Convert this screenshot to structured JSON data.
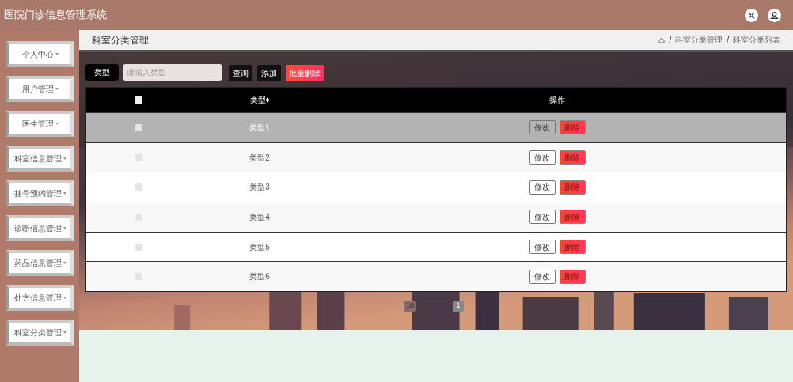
{
  "header": {
    "title": "医院门诊信息管理系统"
  },
  "sidebar": {
    "items": [
      {
        "label": "个人中心"
      },
      {
        "label": "用户管理"
      },
      {
        "label": "医生管理"
      },
      {
        "label": "科室信息管理"
      },
      {
        "label": "挂号预约管理"
      },
      {
        "label": "诊断信息管理"
      },
      {
        "label": "药品信息管理"
      },
      {
        "label": "处方信息管理"
      },
      {
        "label": "科室分类管理"
      }
    ]
  },
  "page": {
    "title": "科室分类管理",
    "breadcrumb": [
      {
        "kind": "separator",
        "text": "/"
      },
      {
        "kind": "link",
        "text": "科室分类管理"
      },
      {
        "kind": "separator",
        "text": "/"
      },
      {
        "kind": "link",
        "text": "科室分类列表"
      }
    ]
  },
  "search": {
    "label": "类型",
    "placeholder": "请输入类型",
    "buttons": [
      {
        "label": "查询",
        "kind": "normal"
      },
      {
        "label": "添加",
        "kind": "normal"
      },
      {
        "label": "批量删除",
        "kind": "danger"
      }
    ]
  },
  "table": {
    "columns": [
      "类型",
      "操作"
    ],
    "all_checked": false,
    "rows": [
      {
        "type": "类型1",
        "checked": false,
        "selected": true,
        "actions": [
          "修改",
          "删除"
        ]
      },
      {
        "type": "类型2",
        "checked": false,
        "selected": false,
        "actions": [
          "修改",
          "删除"
        ]
      },
      {
        "type": "类型3",
        "checked": false,
        "selected": false,
        "actions": [
          "修改",
          "删除"
        ]
      },
      {
        "type": "类型4",
        "checked": false,
        "selected": false,
        "actions": [
          "修改",
          "删除"
        ]
      },
      {
        "type": "类型5",
        "checked": false,
        "selected": false,
        "actions": [
          "修改",
          "删除"
        ]
      },
      {
        "type": "类型6",
        "checked": false,
        "selected": false,
        "actions": [
          "修改",
          "删除"
        ]
      }
    ]
  },
  "pagination": {
    "page_size": "10",
    "pages": [
      {
        "label": "1",
        "selected": true
      }
    ]
  }
}
